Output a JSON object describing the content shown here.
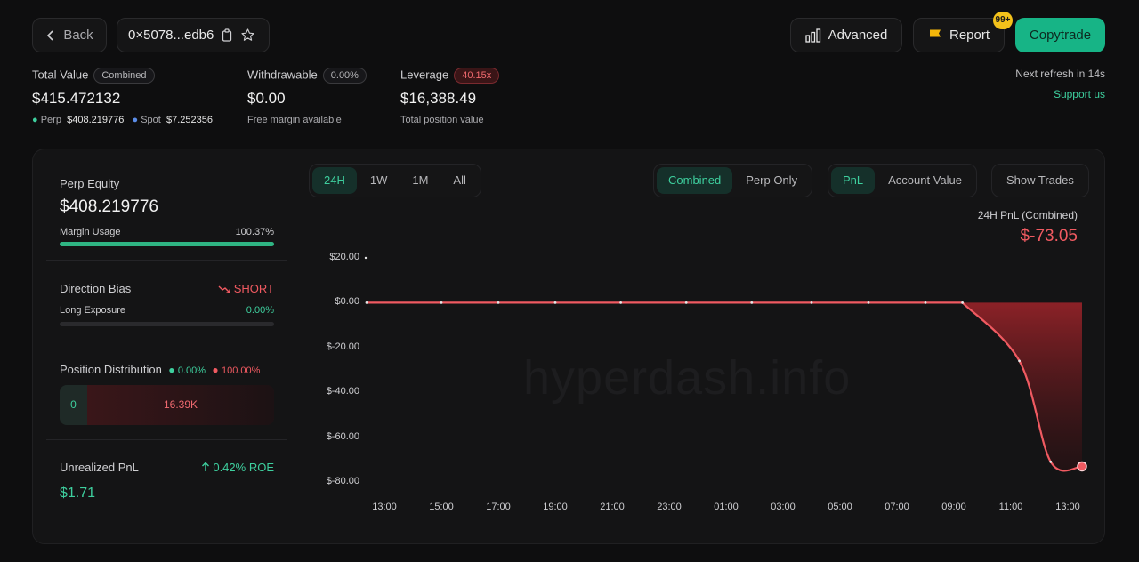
{
  "header": {
    "back_label": "Back",
    "address": "0×5078...edb6",
    "advanced_label": "Advanced",
    "report_label": "Report",
    "report_badge": "99+",
    "copytrade_label": "Copytrade",
    "refresh_text": "Next refresh in 14s",
    "support_label": "Support us"
  },
  "summary": {
    "total_value_label": "Total Value",
    "total_value_tag": "Combined",
    "total_value": "$415.472132",
    "perp_label": "Perp",
    "perp_value": "$408.219776",
    "spot_label": "Spot",
    "spot_value": "$7.252356",
    "withdrawable_label": "Withdrawable",
    "withdrawable_tag": "0.00%",
    "withdrawable_value": "$0.00",
    "withdrawable_sub": "Free margin available",
    "leverage_label": "Leverage",
    "leverage_tag": "40.15x",
    "leverage_value": "$16,388.49",
    "leverage_sub": "Total position value"
  },
  "sidebar": {
    "perp_equity_label": "Perp Equity",
    "perp_equity_value": "$408.219776",
    "margin_usage_label": "Margin Usage",
    "margin_usage_value": "100.37%",
    "margin_usage_fraction": 1.0,
    "direction_bias_label": "Direction Bias",
    "direction_bias_value": "SHORT",
    "long_exposure_label": "Long Exposure",
    "long_exposure_value": "0.00%",
    "long_exposure_fraction": 0,
    "position_dist_label": "Position Distribution",
    "position_dist_long": "0.00%",
    "position_dist_short": "100.00%",
    "position_long_amount": "0",
    "position_short_amount": "16.39K",
    "unrealized_label": "Unrealized PnL",
    "unrealized_roe": "0.42% ROE",
    "unrealized_value": "$1.71"
  },
  "controls": {
    "ranges": [
      "24H",
      "1W",
      "1M",
      "All"
    ],
    "range_selected": "24H",
    "scopes": [
      "Combined",
      "Perp Only"
    ],
    "scope_selected": "Combined",
    "metrics": [
      "PnL",
      "Account Value"
    ],
    "metric_selected": "PnL",
    "show_trades_label": "Show Trades"
  },
  "chart_title": "24H PnL (Combined)",
  "chart_value": "$-73.05",
  "watermark": "hyperdash.info",
  "colors": {
    "accent": "#3ecf9e",
    "negative": "#f05a61",
    "copytrade": "#17b486"
  },
  "chart_data": {
    "type": "line",
    "ylim": [
      -80,
      20
    ],
    "y_ticks": [
      {
        "value": 20,
        "label": "$20.00"
      },
      {
        "value": 0,
        "label": "$0.00"
      },
      {
        "value": -20,
        "label": "$-20.00"
      },
      {
        "value": -40,
        "label": "$-40.00"
      },
      {
        "value": -60,
        "label": "$-60.00"
      },
      {
        "value": -80,
        "label": "$-80.00"
      }
    ],
    "x_ticks": [
      "13:00",
      "15:00",
      "17:00",
      "19:00",
      "21:00",
      "23:00",
      "01:00",
      "03:00",
      "05:00",
      "07:00",
      "09:00",
      "11:00",
      "13:00"
    ],
    "x_index": [
      0,
      1,
      2,
      3,
      4.15,
      5.3,
      6.45,
      7.5,
      8.5,
      9.5,
      10.15,
      11.15,
      11.7,
      12.5
    ],
    "values": [
      0,
      0,
      0,
      0,
      0,
      0,
      0,
      0,
      0,
      0,
      0,
      -26,
      -71,
      -73.05
    ]
  }
}
